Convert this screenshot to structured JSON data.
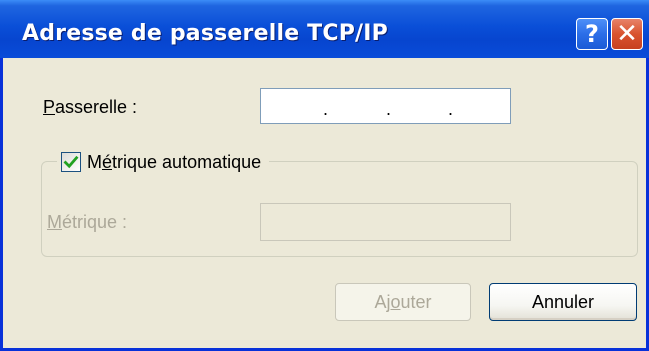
{
  "window": {
    "title": "Adresse de passerelle TCP/IP",
    "help_label": "?",
    "close_label": "✕"
  },
  "gateway": {
    "label_pre": "",
    "label_mnemonic": "P",
    "label_post": "asserelle :",
    "octet_separators": [
      ".",
      ".",
      "."
    ]
  },
  "auto_metric": {
    "checked": true,
    "label_pre": "M",
    "label_mnemonic": "é",
    "label_post": "trique automatique"
  },
  "metric": {
    "label_pre": "",
    "label_mnemonic": "M",
    "label_post": "étrique :",
    "value": "",
    "enabled": false
  },
  "buttons": {
    "add_pre": "Aj",
    "add_mnemonic": "o",
    "add_post": "uter",
    "add_enabled": false,
    "cancel_label": "Annuler"
  },
  "colors": {
    "titlebar": "#0a4fd8",
    "dialog_bg": "#ece9d8",
    "disabled_text": "#aca899",
    "checkmark": "#21a121",
    "close_button": "#d9532f"
  },
  "icons": {
    "help": "help-icon",
    "close": "close-icon",
    "check": "checkmark-icon"
  }
}
